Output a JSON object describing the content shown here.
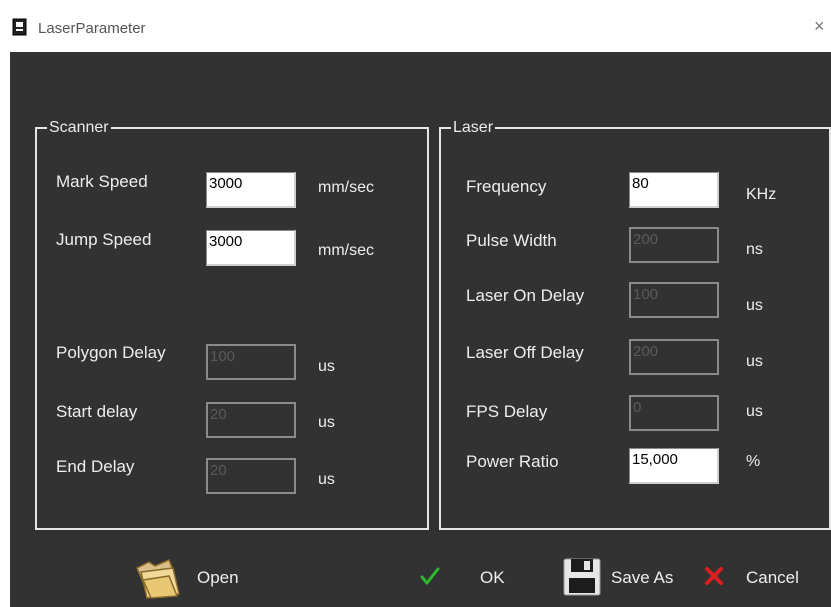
{
  "window": {
    "title": "LaserParameter",
    "close_glyph": "×"
  },
  "scanner": {
    "title": "Scanner",
    "mark_speed": {
      "label": "Mark Speed",
      "value": "3000",
      "unit": "mm/sec"
    },
    "jump_speed": {
      "label": "Jump Speed",
      "value": "3000",
      "unit": "mm/sec"
    },
    "polygon_delay": {
      "label": "Polygon Delay",
      "value": "100",
      "unit": "us"
    },
    "start_delay": {
      "label": "Start delay",
      "value": "20",
      "unit": "us"
    },
    "end_delay": {
      "label": "End Delay",
      "value": "20",
      "unit": "us"
    }
  },
  "laser": {
    "title": "Laser",
    "frequency": {
      "label": "Frequency",
      "value": "80",
      "unit": "KHz"
    },
    "pulse_width": {
      "label": "Pulse Width",
      "value": "200",
      "unit": "ns"
    },
    "laser_on_delay": {
      "label": "Laser On Delay",
      "value": "100",
      "unit": "us"
    },
    "laser_off_delay": {
      "label": "Laser Off Delay",
      "value": "200",
      "unit": "us"
    },
    "fps_delay": {
      "label": "FPS Delay",
      "value": "0",
      "unit": "us"
    },
    "power_ratio": {
      "label": "Power Ratio",
      "value": "15,000",
      "unit": "%"
    }
  },
  "buttons": {
    "open": "Open",
    "ok": "OK",
    "save_as": "Save As",
    "cancel": "Cancel"
  },
  "icons": {
    "app": "document-icon",
    "open": "folder-icon",
    "ok": "check-icon",
    "save": "floppy-icon",
    "cancel": "x-icon"
  },
  "colors": {
    "background": "#323232",
    "text": "#eeeeee",
    "check": "#2db82d",
    "cancel": "#d92020"
  }
}
